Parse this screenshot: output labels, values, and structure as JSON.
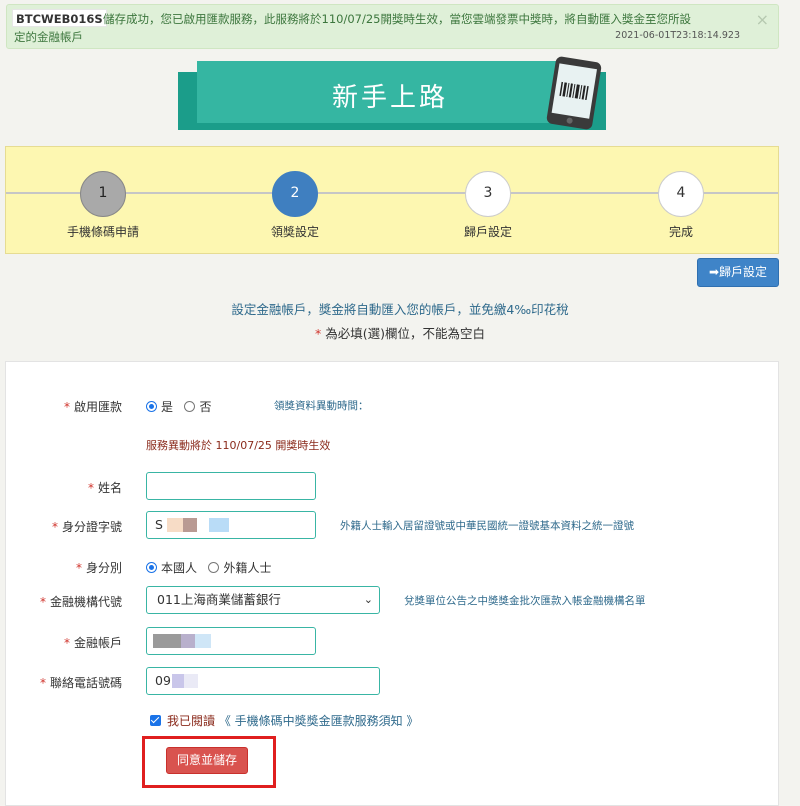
{
  "alert": {
    "code": "BTCWEB016S",
    "message_line1": "儲存成功，您已啟用匯款服務，此服務將於110/07/25開獎時生效，當您雲端發票中獎時，將自動匯入獎金至您所設",
    "message_line2": "定的金融帳戶",
    "timestamp": "2021-06-01T23:18:14.923",
    "close_label": "×"
  },
  "banner": {
    "title": "新手上路"
  },
  "steps": [
    {
      "number": "1",
      "label": "手機條碼申請",
      "state": "done"
    },
    {
      "number": "2",
      "label": "領獎設定",
      "state": "active"
    },
    {
      "number": "3",
      "label": "歸戶設定",
      "state": "pending"
    },
    {
      "number": "4",
      "label": "完成",
      "state": "pending"
    }
  ],
  "toolbar": {
    "next_button_label": "➡歸戶設定"
  },
  "info": {
    "line1": "設定金融帳戶，獎金將自動匯入您的帳戶，並免繳4‰印花稅",
    "required_mark": "*",
    "line2": " 為必填(選)欄位，不能為空白"
  },
  "form": {
    "required_mark": "*",
    "enable_transfer": {
      "label": "啟用匯款",
      "options": [
        "是",
        "否"
      ],
      "selected": "是",
      "change_time_label": "領獎資料異動時間："
    },
    "effective_note": "服務異動將於 110/07/25 開獎時生效",
    "name": {
      "label": "姓名",
      "value": ""
    },
    "id_number": {
      "label": "身分證字號",
      "value_prefix": "S",
      "hint": "外籍人士輸入居留證號或中華民國統一證號基本資料之統一證號"
    },
    "identity": {
      "label": "身分別",
      "options": [
        "本國人",
        "外籍人士"
      ],
      "selected": "本國人"
    },
    "bank_code": {
      "label": "金融機構代號",
      "selected": "011上海商業儲蓄銀行",
      "hint": "兌獎單位公告之中獎獎金批次匯款入帳金融機構名單"
    },
    "account": {
      "label": "金融帳戶",
      "value": ""
    },
    "phone": {
      "label": "聯絡電話號碼",
      "value_prefix": "09"
    },
    "agree": {
      "text": "我已閱讀",
      "link": "《 手機條碼中獎獎金匯款服務須知 》",
      "checked": true
    },
    "submit_label": "同意並儲存"
  },
  "colors": {
    "accent_teal": "#35b6a2",
    "step_active": "#3f7fc0",
    "required_red": "#d0342c",
    "submit_red": "#d9534f",
    "highlight_frame": "#e01f1f"
  }
}
